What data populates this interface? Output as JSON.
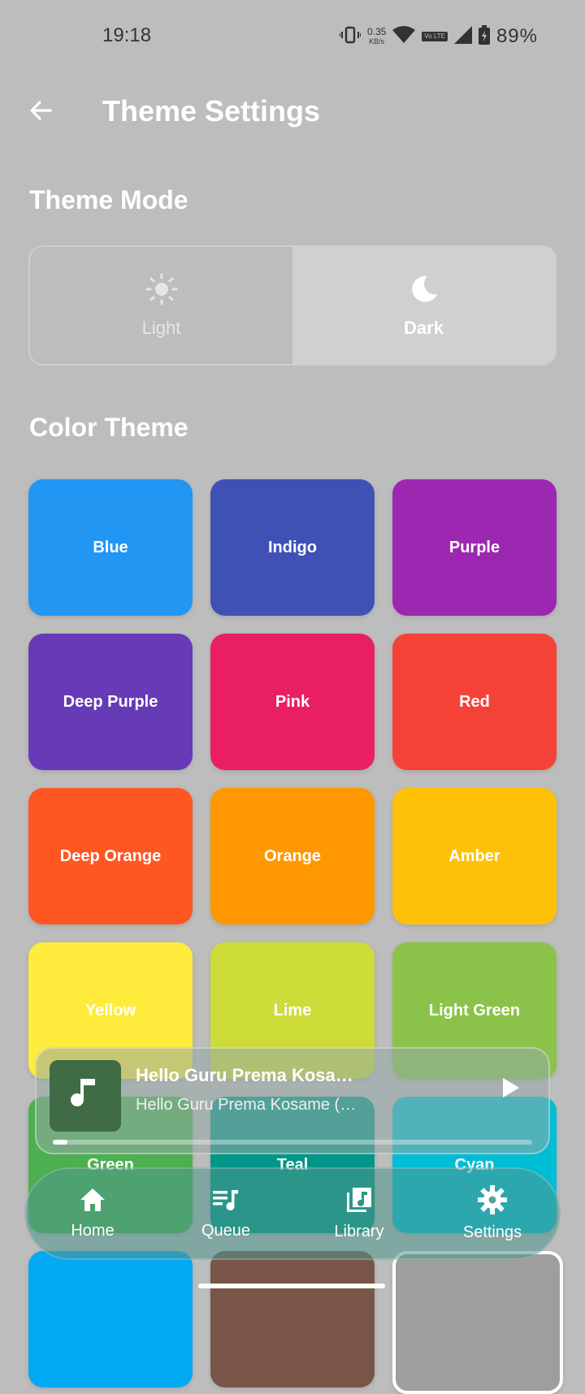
{
  "status_bar": {
    "time": "19:18",
    "net_speed_value": "0.35",
    "net_speed_unit": "KB/s",
    "volte_label": "Vo LTE",
    "battery_percent": "89%"
  },
  "app_bar": {
    "title": "Theme Settings",
    "back_icon": "arrow-left-icon"
  },
  "theme_mode": {
    "section_title": "Theme Mode",
    "options": [
      {
        "label": "Light",
        "icon": "sun-icon",
        "selected": false
      },
      {
        "label": "Dark",
        "icon": "moon-icon",
        "selected": true
      }
    ]
  },
  "color_theme": {
    "section_title": "Color Theme",
    "colors": [
      {
        "label": "Blue",
        "color": "#2196F3"
      },
      {
        "label": "Indigo",
        "color": "#3F51B5"
      },
      {
        "label": "Purple",
        "color": "#9C27B0"
      },
      {
        "label": "Deep Purple",
        "color": "#673AB7"
      },
      {
        "label": "Pink",
        "color": "#E91E63"
      },
      {
        "label": "Red",
        "color": "#F44336"
      },
      {
        "label": "Deep Orange",
        "color": "#FF5722"
      },
      {
        "label": "Orange",
        "color": "#FF9800"
      },
      {
        "label": "Amber",
        "color": "#FFC107"
      },
      {
        "label": "Yellow",
        "color": "#FFEB3B"
      },
      {
        "label": "Lime",
        "color": "#CDDC39"
      },
      {
        "label": "Light Green",
        "color": "#8BC34A"
      },
      {
        "label": "Green",
        "color": "#4CAF50"
      },
      {
        "label": "Teal",
        "color": "#009688"
      },
      {
        "label": "Cyan",
        "color": "#00BCD4"
      },
      {
        "label": "",
        "color": "#03A9F4"
      },
      {
        "label": "",
        "color": "#795548"
      },
      {
        "label": "",
        "color": "#9E9E9E"
      }
    ]
  },
  "mini_player": {
    "title": "Hello Guru Prema Kosa…",
    "subtitle": "Hello Guru Prema Kosame (…",
    "progress": 0.03,
    "icons": [
      "music-note-icon",
      "play-icon"
    ]
  },
  "bottom_nav": {
    "items": [
      {
        "label": "Home",
        "icon": "home-icon"
      },
      {
        "label": "Queue",
        "icon": "queue-music-icon"
      },
      {
        "label": "Library",
        "icon": "library-music-icon"
      },
      {
        "label": "Settings",
        "icon": "gear-icon"
      }
    ]
  }
}
